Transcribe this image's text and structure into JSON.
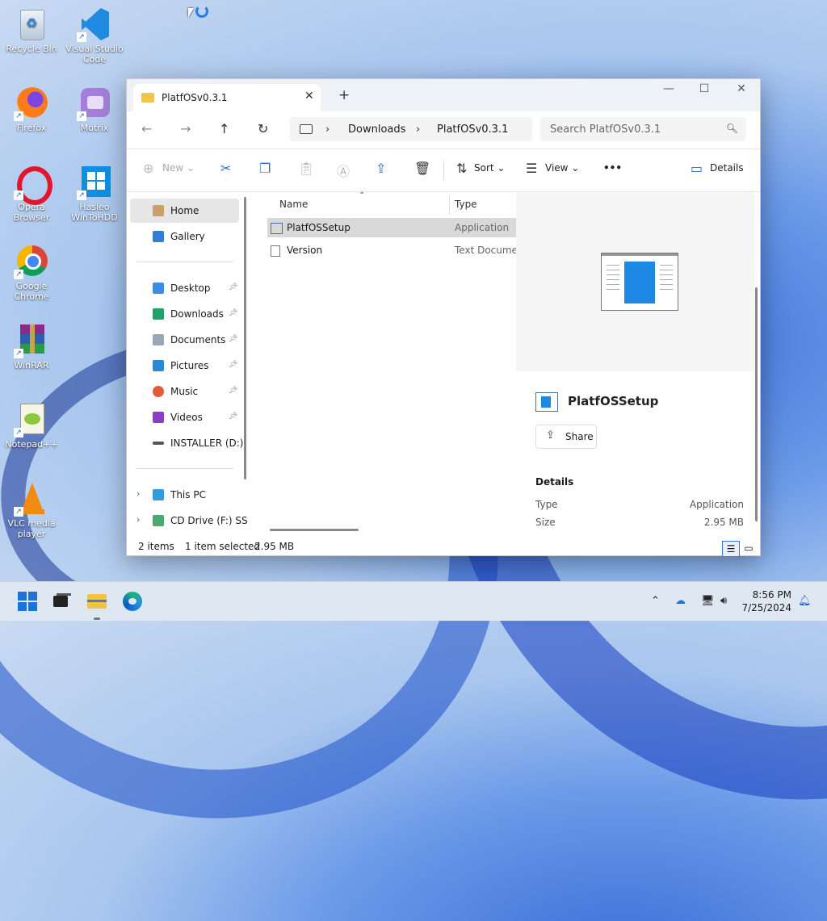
{
  "desktop": {
    "icons": [
      {
        "label": "Recycle Bin",
        "name": "recycle-bin-icon"
      },
      {
        "label": "Visual Studio Code",
        "name": "vscode-icon"
      },
      {
        "label": "Firefox",
        "name": "firefox-icon"
      },
      {
        "label": "Motrix",
        "name": "motrix-icon"
      },
      {
        "label": "Opera Browser",
        "name": "opera-icon"
      },
      {
        "label": "Hasleo WinToHDD",
        "name": "wintohdd-icon"
      },
      {
        "label": "Google Chrome",
        "name": "chrome-icon"
      },
      {
        "label": "WinRAR",
        "name": "winrar-icon"
      },
      {
        "label": "Notepad++",
        "name": "notepadpp-icon"
      },
      {
        "label": "VLC media player",
        "name": "vlc-icon"
      }
    ]
  },
  "window": {
    "tab_title": "PlatfOSv0.3.1",
    "breadcrumb": [
      "Downloads",
      "PlatfOSv0.3.1"
    ],
    "search_placeholder": "Search PlatfOSv0.3.1",
    "toolbar": {
      "new_label": "New",
      "sort_label": "Sort",
      "view_label": "View",
      "more_label": "•••",
      "details_label": "Details"
    },
    "nav": {
      "home": "Home",
      "gallery": "Gallery",
      "quick": [
        "Desktop",
        "Downloads",
        "Documents",
        "Pictures",
        "Music",
        "Videos",
        "INSTALLER (D:)"
      ],
      "this_pc": "This PC",
      "cd_drive": "CD Drive (F:) SSS"
    },
    "columns": {
      "name": "Name",
      "type": "Type"
    },
    "files": [
      {
        "name": "PlatfOSSetup",
        "type": "Application"
      },
      {
        "name": "Version",
        "type": "Text Documen"
      }
    ],
    "preview": {
      "name": "PlatfOSSetup",
      "share_label": "Share",
      "details_header": "Details",
      "type_key": "Type",
      "type_val": "Application",
      "size_key": "Size",
      "size_val": "2.95 MB"
    },
    "status": {
      "items": "2 items",
      "selected": "1 item selected",
      "size": "2.95 MB"
    }
  },
  "taskbar": {
    "time": "8:56 PM",
    "date": "7/25/2024"
  }
}
